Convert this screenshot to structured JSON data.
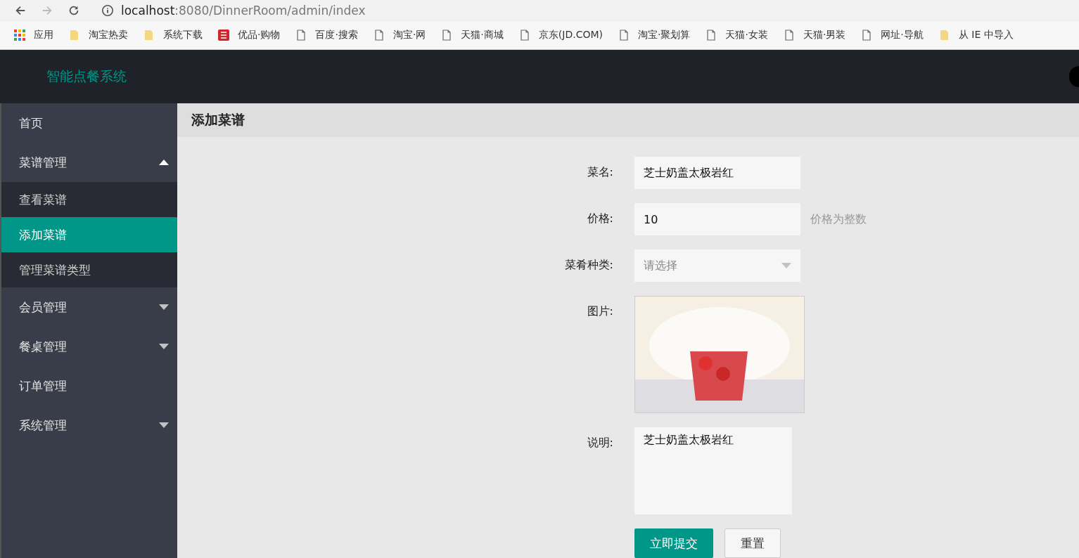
{
  "browser": {
    "url_host": "localhost",
    "url_path": ":8080/DinnerRoom/admin/index",
    "bookmarks": [
      {
        "kind": "apps",
        "label": "应用"
      },
      {
        "kind": "folder",
        "label": "淘宝热卖"
      },
      {
        "kind": "folder",
        "label": "系统下载"
      },
      {
        "kind": "taobao",
        "label": "优品·购物"
      },
      {
        "kind": "page",
        "label": "百度·搜索"
      },
      {
        "kind": "page",
        "label": "淘宝·网"
      },
      {
        "kind": "page",
        "label": "天猫·商城"
      },
      {
        "kind": "page",
        "label": "京东(JD.COM)"
      },
      {
        "kind": "page",
        "label": "淘宝·聚划算"
      },
      {
        "kind": "page",
        "label": "天猫·女装"
      },
      {
        "kind": "page",
        "label": "天猫·男装"
      },
      {
        "kind": "page",
        "label": "网址·导航"
      },
      {
        "kind": "folder",
        "label": "从 IE 中导入"
      }
    ]
  },
  "header": {
    "title": "智能点餐系统"
  },
  "sidebar": {
    "items": [
      {
        "label": "首页",
        "selected": false
      },
      {
        "label": "菜谱管理",
        "selected": false,
        "expanded": true,
        "children": [
          {
            "label": "查看菜谱",
            "selected": false
          },
          {
            "label": "添加菜谱",
            "selected": true
          },
          {
            "label": "管理菜谱类型",
            "selected": false
          }
        ]
      },
      {
        "label": "会员管理",
        "selected": false,
        "expanded": false
      },
      {
        "label": "餐桌管理",
        "selected": false,
        "expanded": false
      },
      {
        "label": "订单管理",
        "selected": false
      },
      {
        "label": "系统管理",
        "selected": false,
        "expanded": false
      }
    ]
  },
  "page_title": "添加菜谱",
  "form": {
    "fields": [
      {
        "kind": "text",
        "label": "菜名:",
        "value": "芝士奶盖太极岩红"
      },
      {
        "kind": "text",
        "label": "价格:",
        "value": "10",
        "hint": "价格为整数"
      },
      {
        "kind": "select",
        "label": "菜肴种类:",
        "placeholder": "请选择"
      },
      {
        "kind": "image",
        "label": "图片:"
      },
      {
        "kind": "textarea",
        "label": "说明:",
        "value": "芝士奶盖太极岩红"
      }
    ],
    "buttons": [
      {
        "kind": "primary",
        "label": "立即提交"
      },
      {
        "kind": "plain",
        "label": "重置"
      }
    ]
  }
}
